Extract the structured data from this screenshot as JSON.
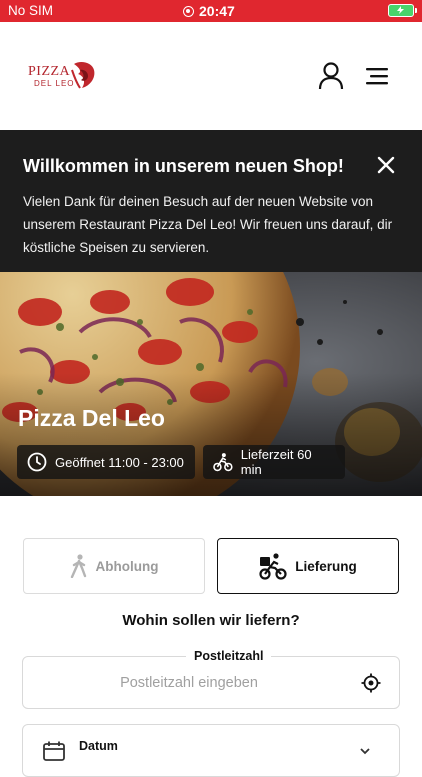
{
  "statusbar": {
    "carrier": "No SIM",
    "time": "20:47"
  },
  "header": {
    "logo_top": "PIZZA",
    "logo_bottom": "DEL LEO"
  },
  "welcome": {
    "title": "Willkommen in unserem neuen Shop!",
    "text": "Vielen Dank für deinen Besuch auf der neuen Website von unserem Restaurant Pizza Del Leo! Wir freuen uns darauf, dir köstliche Speisen zu servieren."
  },
  "hero": {
    "name": "Pizza Del Leo",
    "hours": "Geöffnet 11:00 - 23:00",
    "delivery_time": "Lieferzeit 60 min"
  },
  "order_mode": {
    "pickup": "Abholung",
    "delivery": "Lieferung"
  },
  "question": "Wohin sollen wir liefern?",
  "zip": {
    "label": "Postleitzahl",
    "placeholder": "Postleitzahl eingeben"
  },
  "date": {
    "label": "Datum"
  },
  "colors": {
    "brand": "#e0272f",
    "banner": "#1d1d1d"
  }
}
